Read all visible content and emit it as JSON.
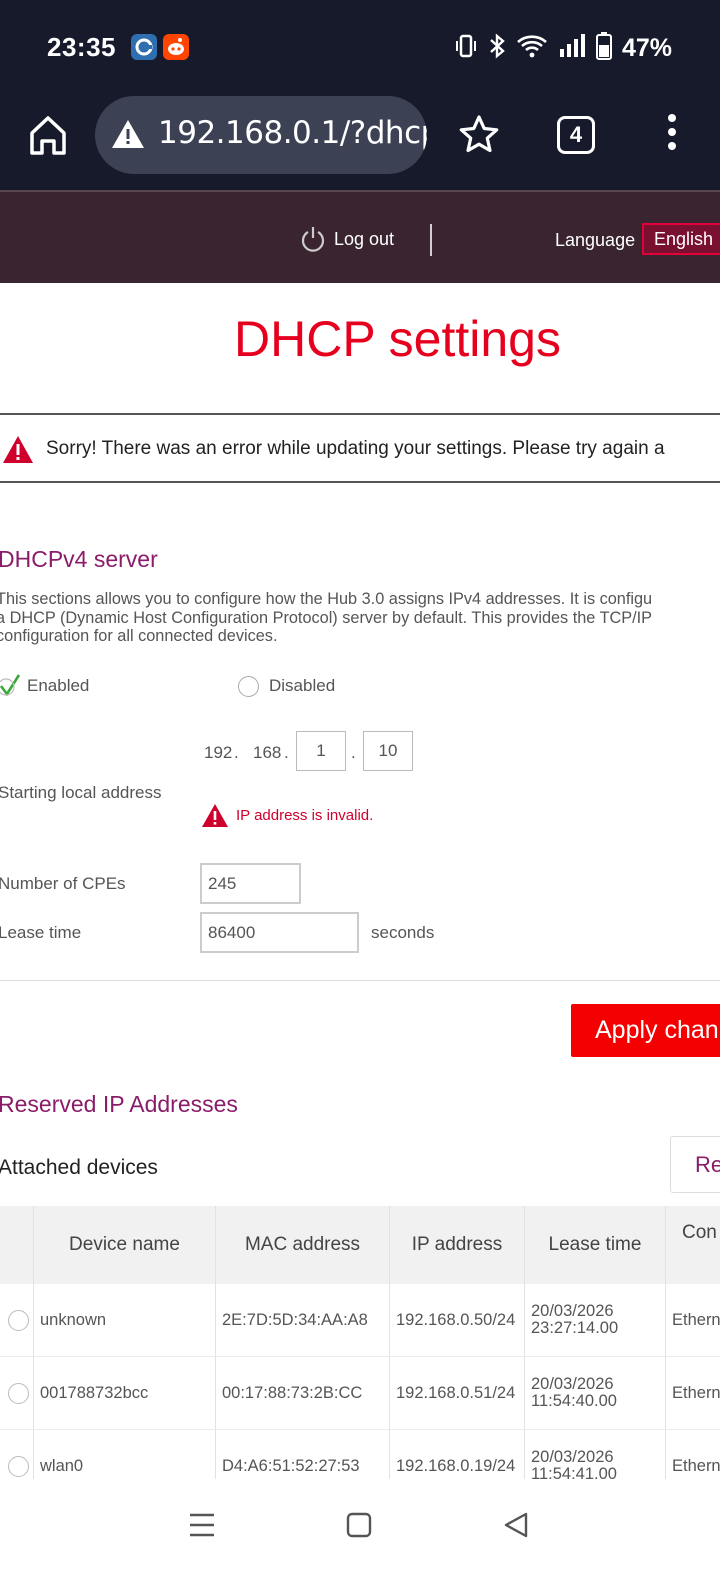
{
  "status_bar": {
    "time": "23:35",
    "battery": "47%",
    "icons": [
      "app-c-icon",
      "reddit-icon",
      "vibrate-icon",
      "bluetooth-icon",
      "wifi-icon",
      "signal-icon",
      "battery-icon"
    ]
  },
  "browser": {
    "url": "192.168.0.1/?dhcp",
    "tab_count": "4"
  },
  "router_header": {
    "logout_label": "Log out",
    "language_label": "Language",
    "language_value": "English"
  },
  "page": {
    "title": "DHCP settings",
    "error_message": "Sorry! There was an error while updating your settings. Please try again a"
  },
  "dhcpv4": {
    "section_title": "DHCPv4 server",
    "description_lines": [
      "This sections allows you to configure how the Hub 3.0 assigns IPv4 addresses. It is configu",
      "a DHCP (Dynamic Host Configuration Protocol) server by default. This provides the TCP/IP",
      "configuration for all connected devices."
    ],
    "enabled_label": "Enabled",
    "disabled_label": "Disabled",
    "starting_address_label": "Starting local address",
    "ip_octet_1": "192",
    "ip_octet_2": "168",
    "ip_octet_3": "1",
    "ip_octet_4": "10",
    "ip_error": "IP address is invalid.",
    "cpes_label": "Number of CPEs",
    "cpes_value": "245",
    "lease_label": "Lease time",
    "lease_value": "86400",
    "lease_unit": "seconds",
    "apply_label": "Apply chan"
  },
  "reserved": {
    "section_title": "Reserved IP Addresses",
    "attached_label": "Attached devices",
    "reserve_button": "Re",
    "columns": [
      "Device name",
      "MAC address",
      "IP address",
      "Lease time",
      "Con"
    ],
    "rows": [
      {
        "name": "unknown",
        "mac": "2E:7D:5D:34:AA:A8",
        "ip": "192.168.0.50/24",
        "lease_date": "20/03/2026",
        "lease_time": "23:27:14.00",
        "conn": "Ethern"
      },
      {
        "name": "001788732bcc",
        "mac": "00:17:88:73:2B:CC",
        "ip": "192.168.0.51/24",
        "lease_date": "20/03/2026",
        "lease_time": "11:54:40.00",
        "conn": "Ethern"
      },
      {
        "name": "wlan0",
        "mac": "D4:A6:51:52:27:53",
        "ip": "192.168.0.19/24",
        "lease_date": "20/03/2026",
        "lease_time": "11:54:41.00",
        "conn": "Ethern"
      }
    ]
  },
  "colors": {
    "accent_red": "#e6001e",
    "section_purple": "#8a1c6a",
    "header_bg": "#3a2430",
    "system_bg": "#161a2b"
  }
}
